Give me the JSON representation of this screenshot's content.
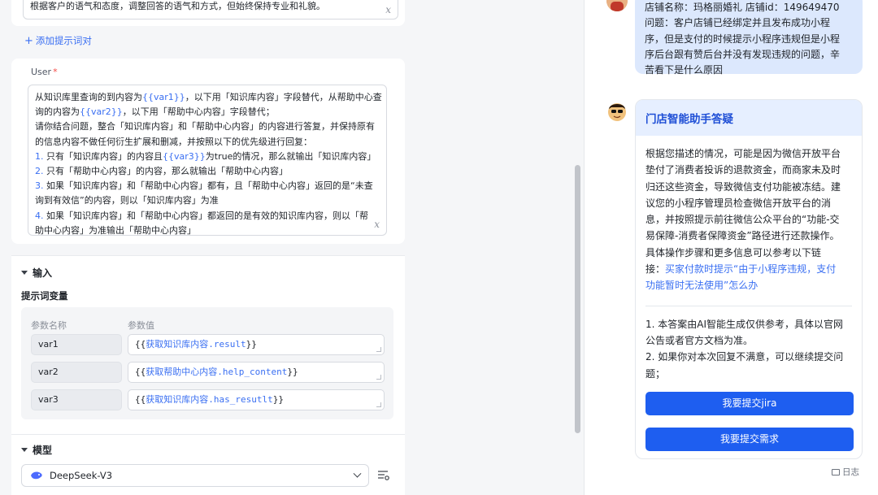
{
  "prompt_editor": {
    "system_tail_text": "根据客户的语气和态度，调整回答的语气和方式，但始终保持专业和礼貌。",
    "add_prompt_label": "添加提示词对",
    "user_role_label": "User",
    "user_required_mark": "*",
    "user_prompt_lines": [
      [
        {
          "t": "从知识库里查询的到内容为"
        },
        {
          "t": "{{var1}}",
          "c": "var"
        },
        {
          "t": "，以下用「知识库内容」字段替代，从帮助中心查"
        }
      ],
      [
        {
          "t": "询的内容为"
        },
        {
          "t": "{{var2}}",
          "c": "var"
        },
        {
          "t": "，以下用「帮助中心内容」字段替代；"
        }
      ],
      [
        {
          "t": "请你结合问题，整合「知识库内容」和「帮助中心内容」的内容进行答复，并保持原有"
        }
      ],
      [
        {
          "t": "的信息内容不做任何衍生扩展和删减，并按照以下的优先级进行回复："
        }
      ],
      [
        {
          "t": "1.",
          "c": "num"
        },
        {
          "t": " 只有「知识库内容」的内容且"
        },
        {
          "t": "{{var3}}",
          "c": "var"
        },
        {
          "t": "为true的情况，那么就输出「知识库内容」"
        }
      ],
      [
        {
          "t": "2.",
          "c": "num"
        },
        {
          "t": " 只有「帮助中心内容」的内容，那么就输出「帮助中心内容」"
        }
      ],
      [
        {
          "t": "3.",
          "c": "num"
        },
        {
          "t": " 如果「知识库内容」和「帮助中心内容」都有，且「帮助中心内容」返回的是“未查"
        }
      ],
      [
        {
          "t": "询到有效信"
        },
        {
          "t": "”的内容，则以「知识库内容」为准"
        }
      ],
      [
        {
          "t": "4.",
          "c": "num"
        },
        {
          "t": " 如果「知识库内容」和「帮助中心内容」都返回的是有效的知识库内容，则以「帮"
        }
      ],
      [
        {
          "t": "助中心内容」为准输出「帮助中心内容」"
        }
      ]
    ],
    "fx_symbol": "x"
  },
  "input_section": {
    "title": "输入",
    "prompt_vars_title": "提示词变量",
    "col_name": "参数名称",
    "col_value": "参数值",
    "vars": [
      {
        "name": "var1",
        "open": "{{",
        "node": "获取知识库内容",
        "field": ".result",
        "close": "}}"
      },
      {
        "name": "var2",
        "open": "{{",
        "node": "获取帮助中心内容",
        "field": ".help_content",
        "close": "}}"
      },
      {
        "name": "var3",
        "open": "{{",
        "node": "获取知识库内容",
        "field": ".has_resutlt",
        "close": "}}"
      }
    ]
  },
  "model_section": {
    "title": "模型",
    "selected_model": "DeepSeek-V3"
  },
  "chat": {
    "user_message": "店铺名称：玛格丽婚礼 店铺id：149649470\n问题：客户店铺已经绑定并且发布成功小程序，但是支付的时候提示小程序违规但是小程序后台跟有赞后台并没有发现违规的问题，辛苦看下是什么原因",
    "user_lines": [
      "店铺名称：玛格丽婚礼 店铺id：149649470",
      "问题：客户店铺已经绑定并且发布成功小程",
      "序，但是支付的时候提示小程序违规但是小程",
      "序后台跟有赞后台并没有发现违规的问题，辛",
      "苦看下是什么原因"
    ],
    "answer_title": "门店智能助手答疑",
    "answer_lines": [
      "根据您描述的情况，可能是因为微信开放平台",
      "垫付了消费者投诉的退款资金，而商家未及时",
      "归还这些资金，导致微信支付功能被冻结。建",
      "议您的小程序管理员检查微信开放平台的消",
      "息，并按照提示前往微信公众平台的“功能-交",
      "易保障-消费者保障资金”路径进行还款操作。",
      "具体操作步骤和更多信息可以参考以下链"
    ],
    "answer_link_prefix": "接：",
    "answer_link_1": "买家付款时提示“由于小程序违规，支付",
    "answer_link_2": "功能暂时无法使用”怎么办",
    "note_lines": [
      "1. 本答案由AI智能生成仅供参考，具体以官网",
      "公告或者官方文档为准。",
      "2. 如果你对本次回复不满意，可以继续提交问",
      "题；"
    ],
    "btn_jira": "我要提交jira",
    "btn_demand": "我要提交需求",
    "log_label": "日志"
  }
}
